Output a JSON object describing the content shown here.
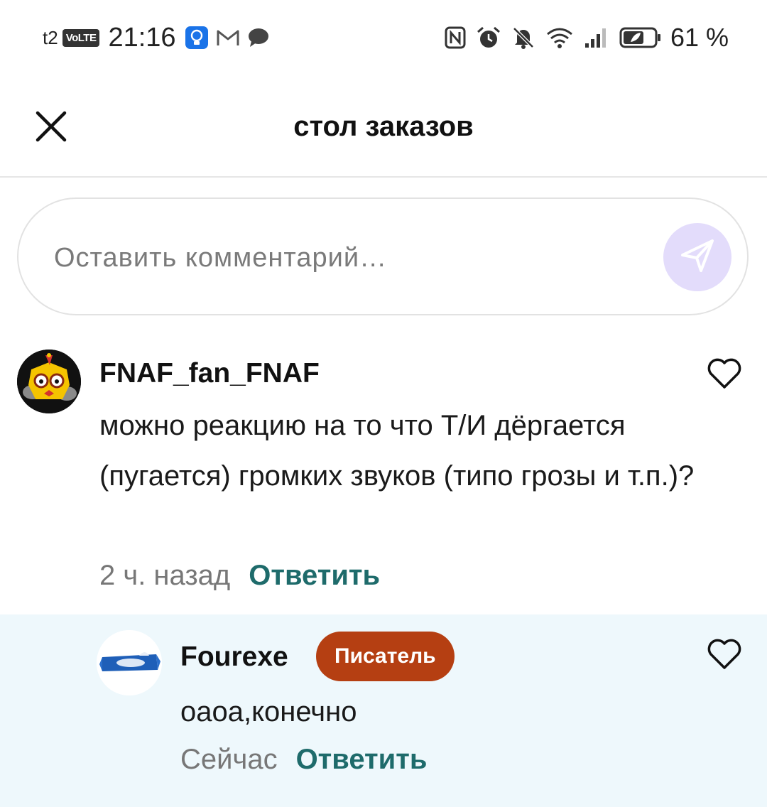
{
  "status_bar": {
    "carrier": "t2",
    "volte": "VoLTE",
    "time": "21:16",
    "battery_percent": "61 %",
    "left_icons": [
      "lightbulb-app-icon",
      "gmail-icon",
      "chat-bubble-icon"
    ],
    "right_icons": [
      "nfc-icon",
      "alarm-icon",
      "mute-icon",
      "wifi-icon",
      "signal-icon",
      "battery-icon"
    ]
  },
  "header": {
    "title": "стол заказов",
    "close_icon": "close-icon"
  },
  "comment_input": {
    "placeholder": "Оставить комментарий…",
    "value": "",
    "send_icon": "send-icon"
  },
  "comments": [
    {
      "username": "FNAF_fan_FNAF",
      "text": "можно реакцию на то что Т/И дёргается (пугается) громких звуков (типо грозы и т.п.)?",
      "timestamp": "2 ч. назад",
      "reply_label": "Ответить",
      "like_icon": "heart-outline-icon"
    },
    {
      "username": "Fourexe",
      "badge": "Писатель",
      "text": "оаоа,конечно",
      "timestamp": "Сейчас",
      "reply_label": "Ответить",
      "like_icon": "heart-outline-icon"
    }
  ],
  "colors": {
    "accent": "#1e6b6b",
    "badge": "#b53f12",
    "send_button": "#e3dcfb",
    "reply_background": "#eef8fc"
  }
}
